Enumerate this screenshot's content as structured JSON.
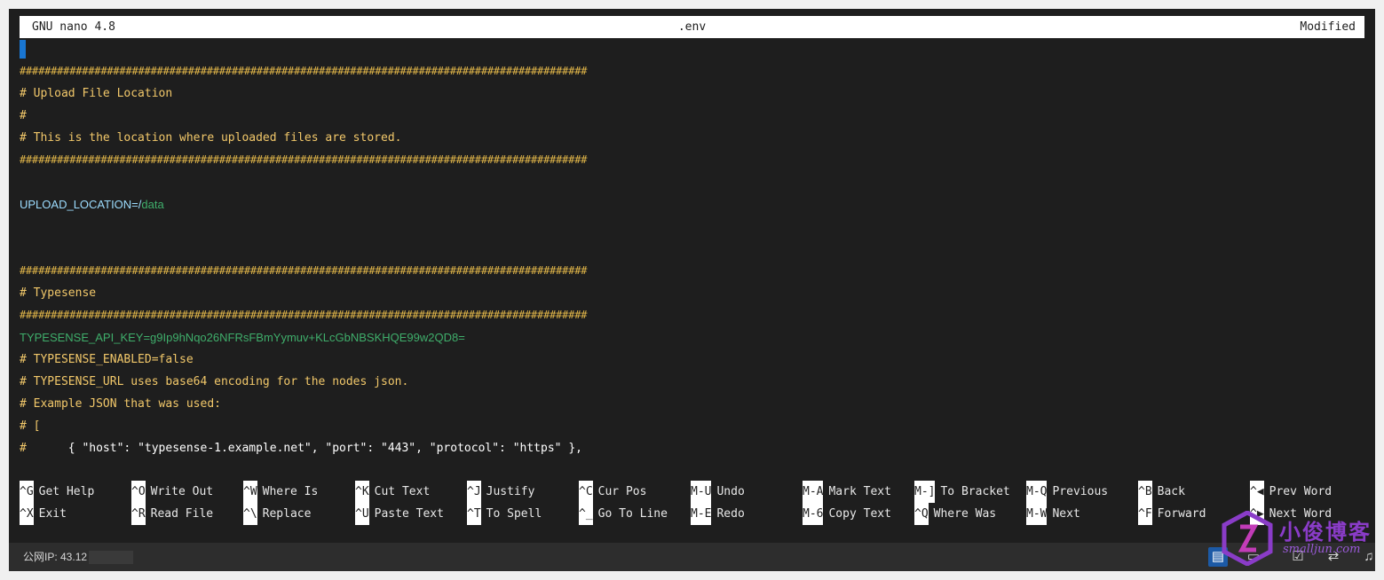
{
  "titlebar": {
    "app": "GNU nano 4.8",
    "filename": ".env",
    "status": "Modified"
  },
  "lines": [
    {
      "type": "hash",
      "text": "###########################################################################################"
    },
    {
      "type": "comment",
      "text": "# Upload File Location"
    },
    {
      "type": "comment",
      "text": "#"
    },
    {
      "type": "comment",
      "text": "# This is the location where uploaded files are stored."
    },
    {
      "type": "hash",
      "text": "###########################################################################################"
    },
    {
      "type": "blank",
      "text": ""
    },
    {
      "type": "kv",
      "key": "UPLOAD_LOCATION=/",
      "value": "data"
    },
    {
      "type": "blank",
      "text": ""
    },
    {
      "type": "blank",
      "text": ""
    },
    {
      "type": "hash",
      "text": "###########################################################################################"
    },
    {
      "type": "comment",
      "text": "# Typesense"
    },
    {
      "type": "hash",
      "text": "###########################################################################################"
    },
    {
      "type": "key",
      "text": "TYPESENSE_API_KEY=g9Ip9hNqo26NFRsFBmYymuv+KLcGbNBSKHQE99w2QD8="
    },
    {
      "type": "comment",
      "text": "# TYPESENSE_ENABLED=false"
    },
    {
      "type": "comment",
      "text": "# TYPESENSE_URL uses base64 encoding for the nodes json."
    },
    {
      "type": "comment",
      "text": "# Example JSON that was used:"
    },
    {
      "type": "comment",
      "text": "# ["
    },
    {
      "type": "mixed",
      "prefix": "#      ",
      "rest": "{ \"host\": \"typesense-1.example.net\", \"port\": \"443\", \"protocol\": \"https\" },"
    }
  ],
  "shortcuts": {
    "row1": [
      {
        "key": "^G",
        "label": "Get Help"
      },
      {
        "key": "^O",
        "label": "Write Out"
      },
      {
        "key": "^W",
        "label": "Where Is"
      },
      {
        "key": "^K",
        "label": "Cut Text"
      },
      {
        "key": "^J",
        "label": "Justify"
      },
      {
        "key": "^C",
        "label": "Cur Pos"
      },
      {
        "key": "M-U",
        "label": "Undo"
      },
      {
        "key": "M-A",
        "label": "Mark Text"
      },
      {
        "key": "M-]",
        "label": "To Bracket"
      },
      {
        "key": "M-Q",
        "label": "Previous"
      },
      {
        "key": "^B",
        "label": "Back"
      },
      {
        "key": "^◀",
        "label": "Prev Word"
      }
    ],
    "row2": [
      {
        "key": "^X",
        "label": "Exit"
      },
      {
        "key": "^R",
        "label": "Read File"
      },
      {
        "key": "^\\",
        "label": "Replace"
      },
      {
        "key": "^U",
        "label": "Paste Text"
      },
      {
        "key": "^T",
        "label": "To Spell"
      },
      {
        "key": "^_",
        "label": "Go To Line"
      },
      {
        "key": "M-E",
        "label": "Redo"
      },
      {
        "key": "M-6",
        "label": "Copy Text"
      },
      {
        "key": "^Q",
        "label": "Where Was"
      },
      {
        "key": "M-W",
        "label": "Next"
      },
      {
        "key": "^F",
        "label": "Forward"
      },
      {
        "key": "^▶",
        "label": "Next Word"
      }
    ]
  },
  "statusbar": {
    "ip_label": "公网IP: 43.12",
    "icons": [
      "clipboard-icon",
      "terminal-icon",
      "checklist-icon",
      "transfer-icon",
      "bell-icon"
    ]
  },
  "watermark": {
    "text": "小俊博客",
    "sub": "smalljun.com"
  },
  "colors": {
    "background": "#1e1e1e",
    "comment": "#f2c86a",
    "variable": "#9cdcfe",
    "value": "#3fae6b",
    "cursor": "#1976d2",
    "statusbar": "#2d2d2d"
  }
}
